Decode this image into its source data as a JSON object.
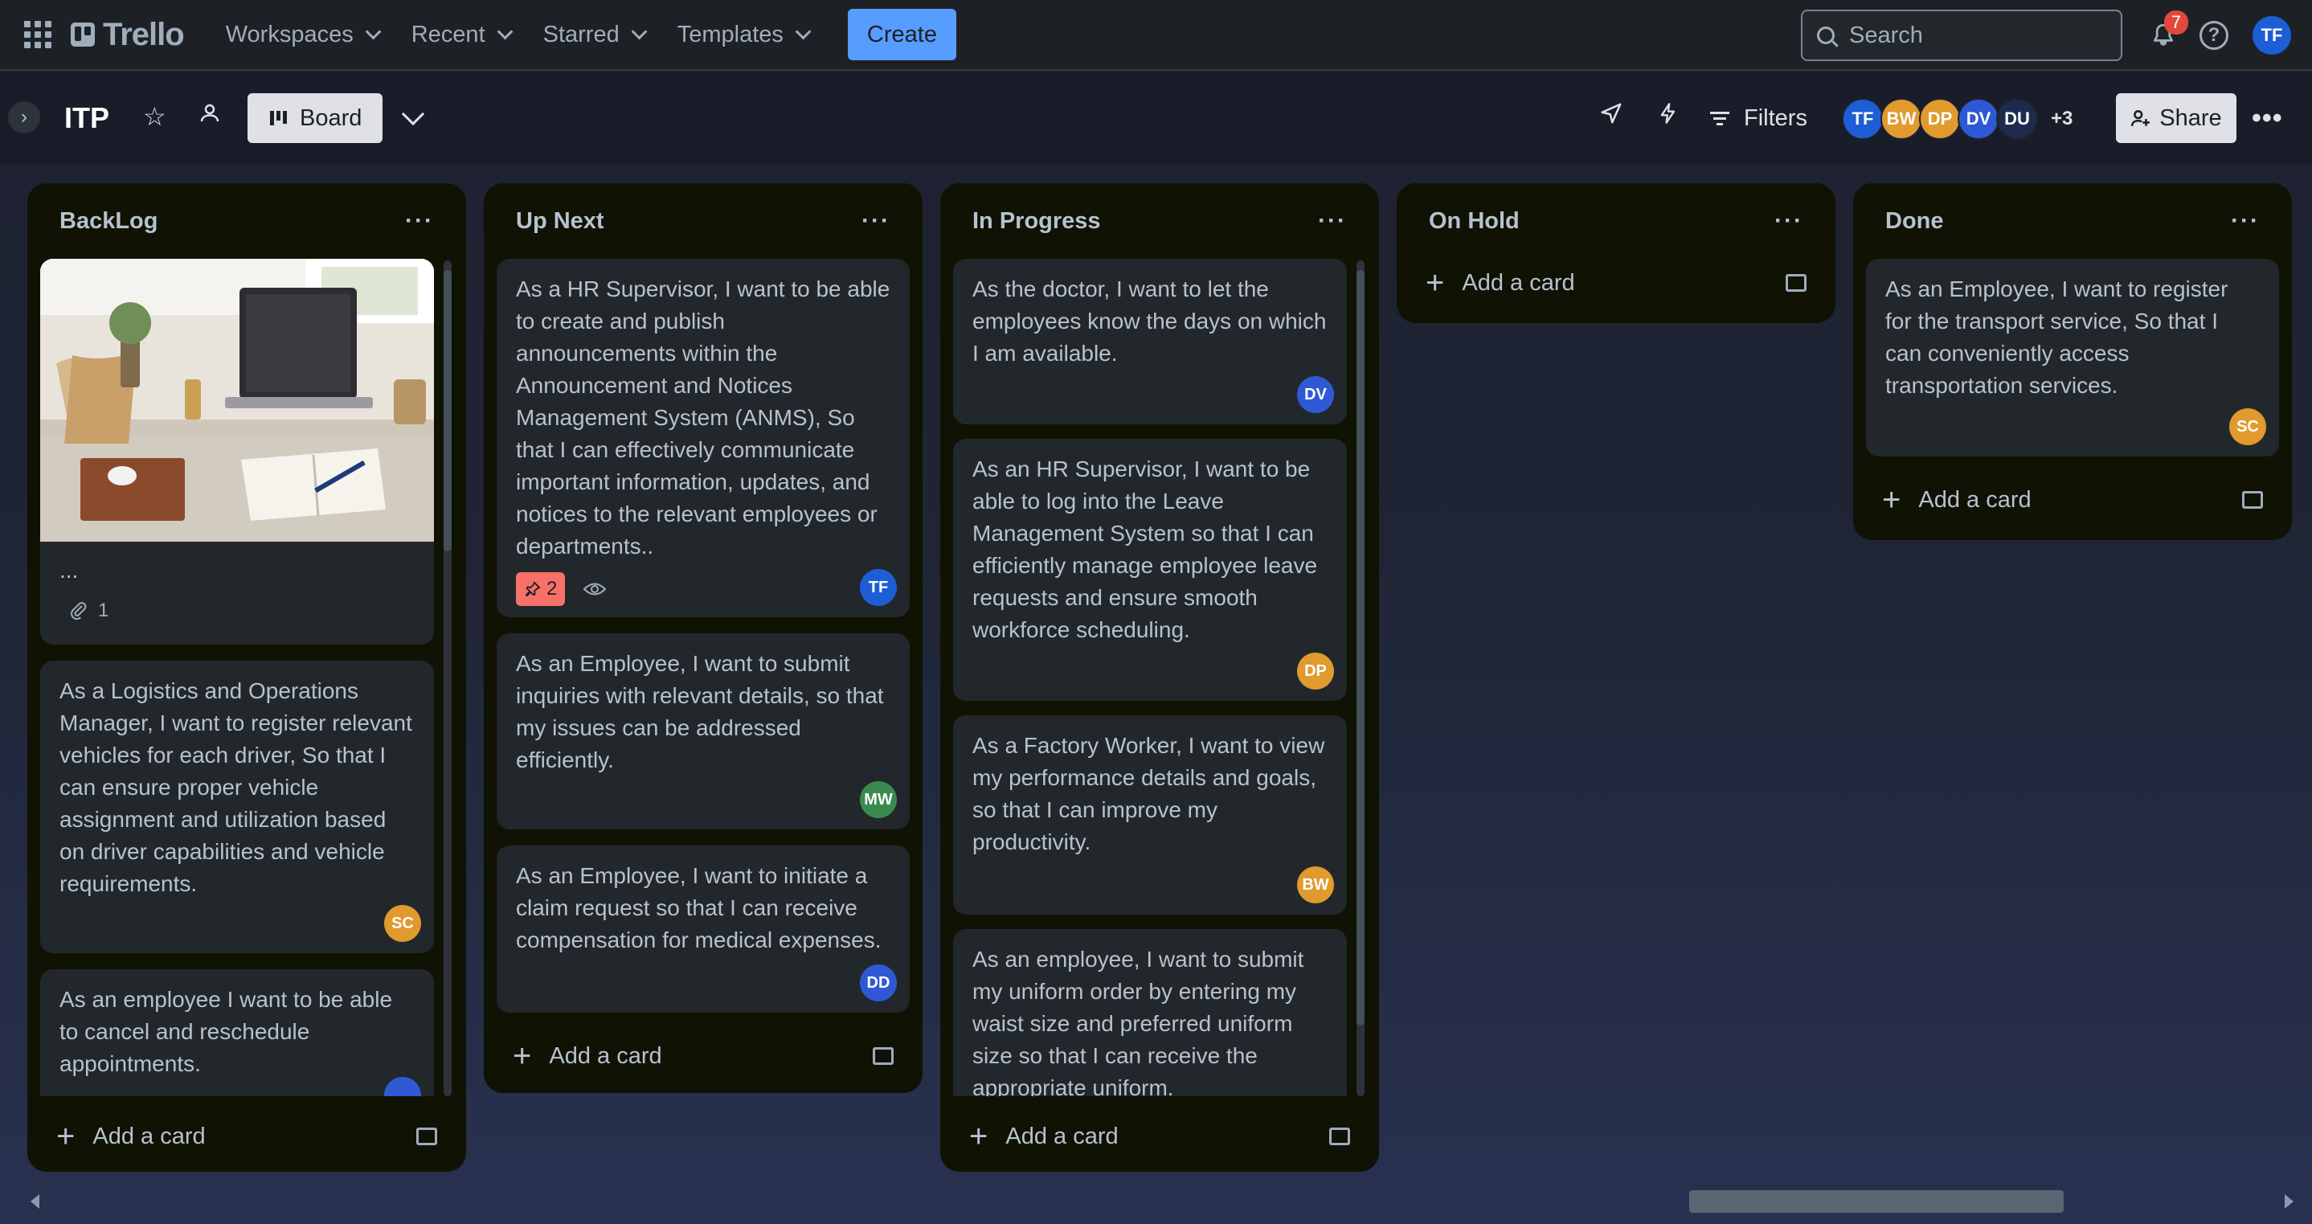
{
  "nav": {
    "logo": "Trello",
    "menus": [
      "Workspaces",
      "Recent",
      "Starred",
      "Templates"
    ],
    "create_label": "Create",
    "search_placeholder": "Search",
    "notification_count": "7",
    "user_initials": "TF"
  },
  "board": {
    "title": "ITP",
    "view_label": "Board",
    "filters_label": "Filters",
    "members": [
      {
        "initials": "TF",
        "color": "#1d5ed6"
      },
      {
        "initials": "BW",
        "color": "#e09a2d"
      },
      {
        "initials": "DP",
        "color": "#e09a2d"
      },
      {
        "initials": "DV",
        "color": "#2f59d4"
      },
      {
        "initials": "DU",
        "color": "#1e2b4c"
      }
    ],
    "members_more": "+3",
    "share_label": "Share"
  },
  "lists": [
    {
      "title": "BackLog",
      "add_card_label": "Add a card",
      "cards": [
        {
          "text": "...",
          "attachments": "1",
          "has_cover": true
        },
        {
          "text": "As a Logistics and Operations Manager, I want to register relevant vehicles for each driver, So that I can ensure proper vehicle assignment and utilization based on driver capabilities and vehicle requirements.",
          "member": "SC",
          "member_color": "#e09a2d"
        },
        {
          "text": "As an employee I want to be able to cancel and reschedule appointments.",
          "member": "",
          "member_color": "#2f59d4"
        }
      ]
    },
    {
      "title": "Up Next",
      "add_card_label": "Add a card",
      "cards": [
        {
          "text": "As a HR Supervisor, I want to be able to create and publish announcements within the Announcement and Notices Management System (ANMS), So that I can effectively communicate important information, updates, and notices to the relevant employees or departments..",
          "votes": "2",
          "member": "TF",
          "member_color": "#1d5ed6"
        },
        {
          "text": "As an Employee, I want to submit inquiries with relevant details, so that my issues can be addressed efficiently.",
          "member": "MW",
          "member_color": "#3a8a4f"
        },
        {
          "text": "As an Employee, I want to initiate a claim request so that I can receive compensation for medical expenses.",
          "member": "DD",
          "member_color": "#2f59d4"
        }
      ]
    },
    {
      "title": "In Progress",
      "add_card_label": "Add a card",
      "cards": [
        {
          "text": "As the doctor, I want to let the employees know the days on which I am available.",
          "member": "DV",
          "member_color": "#2f59d4"
        },
        {
          "text": "As an HR Supervisor, I want to be able to log into the Leave Management System so that I can efficiently manage employee leave requests and ensure smooth workforce scheduling.",
          "member": "DP",
          "member_color": "#e09a2d"
        },
        {
          "text": "As a Factory Worker, I want to view my performance details and goals, so that I can improve my productivity.",
          "member": "BW",
          "member_color": "#e09a2d"
        },
        {
          "text": "As an employee, I want to submit my uniform order by entering my waist size and preferred uniform size so that I can receive the appropriate uniform."
        }
      ]
    },
    {
      "title": "On Hold",
      "add_card_label": "Add a card",
      "cards": []
    },
    {
      "title": "Done",
      "add_card_label": "Add a card",
      "cards": [
        {
          "text": "As an Employee, I want to register for the transport service, So that I can conveniently access transportation services.",
          "member": "SC",
          "member_color": "#e09a2d"
        }
      ]
    }
  ]
}
